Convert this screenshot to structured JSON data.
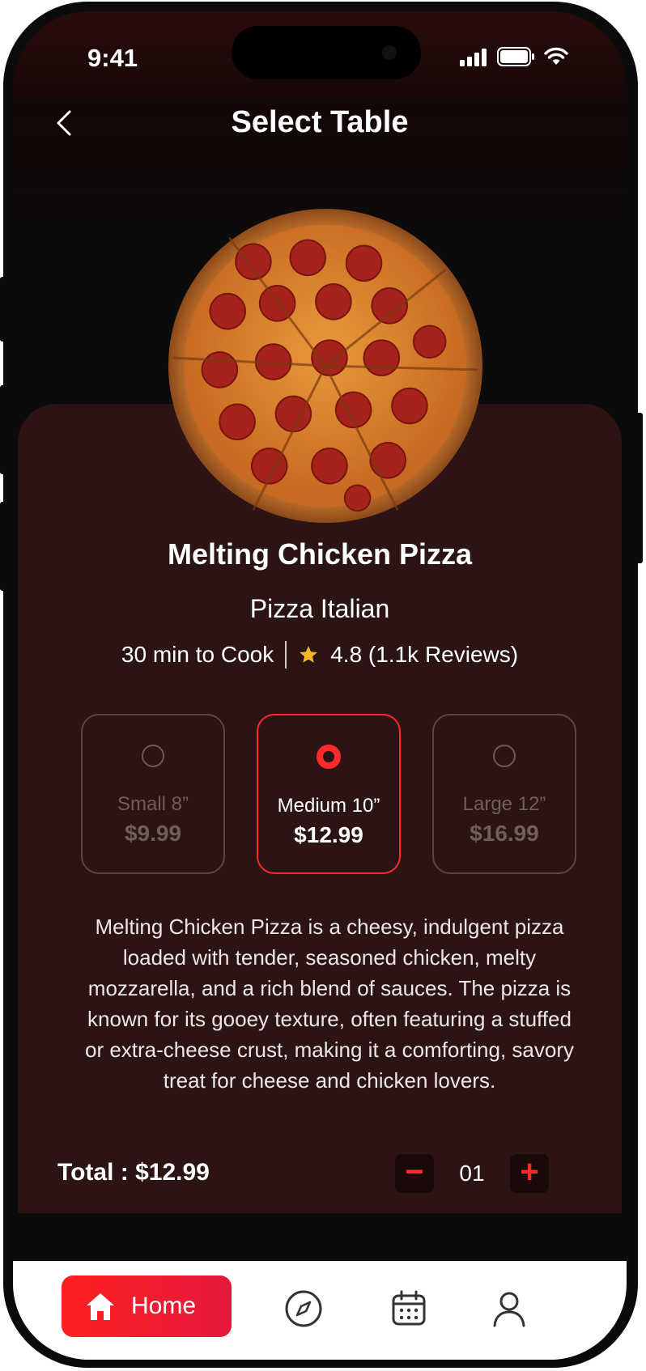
{
  "status": {
    "time": "9:41"
  },
  "header": {
    "title": "Select Table"
  },
  "product": {
    "name": "Melting Chicken Pizza",
    "category": "Pizza Italian",
    "cook_time": "30 min to Cook",
    "rating": "4.8 (1.1k Reviews)"
  },
  "sizes": [
    {
      "label": "Small 8”",
      "price": "$9.99",
      "selected": false
    },
    {
      "label": "Medium 10”",
      "price": "$12.99",
      "selected": true
    },
    {
      "label": "Large 12”",
      "price": "$16.99",
      "selected": false
    }
  ],
  "description": "Melting Chicken Pizza is a cheesy, indulgent pizza loaded with tender, seasoned chicken, melty mozzarella, and a rich blend of sauces. The pizza is known for its gooey texture, often featuring a stuffed or extra-cheese crust, making it a comforting, savory treat for cheese and chicken lovers.",
  "order": {
    "total": "Total : $12.99",
    "quantity": "01",
    "minus": "−",
    "plus": "+"
  },
  "tabbar": {
    "home_label": "Home"
  },
  "colors": {
    "accent": "#ff2a2a",
    "sheet": "#2c1414",
    "background": "#0b0b0b"
  }
}
